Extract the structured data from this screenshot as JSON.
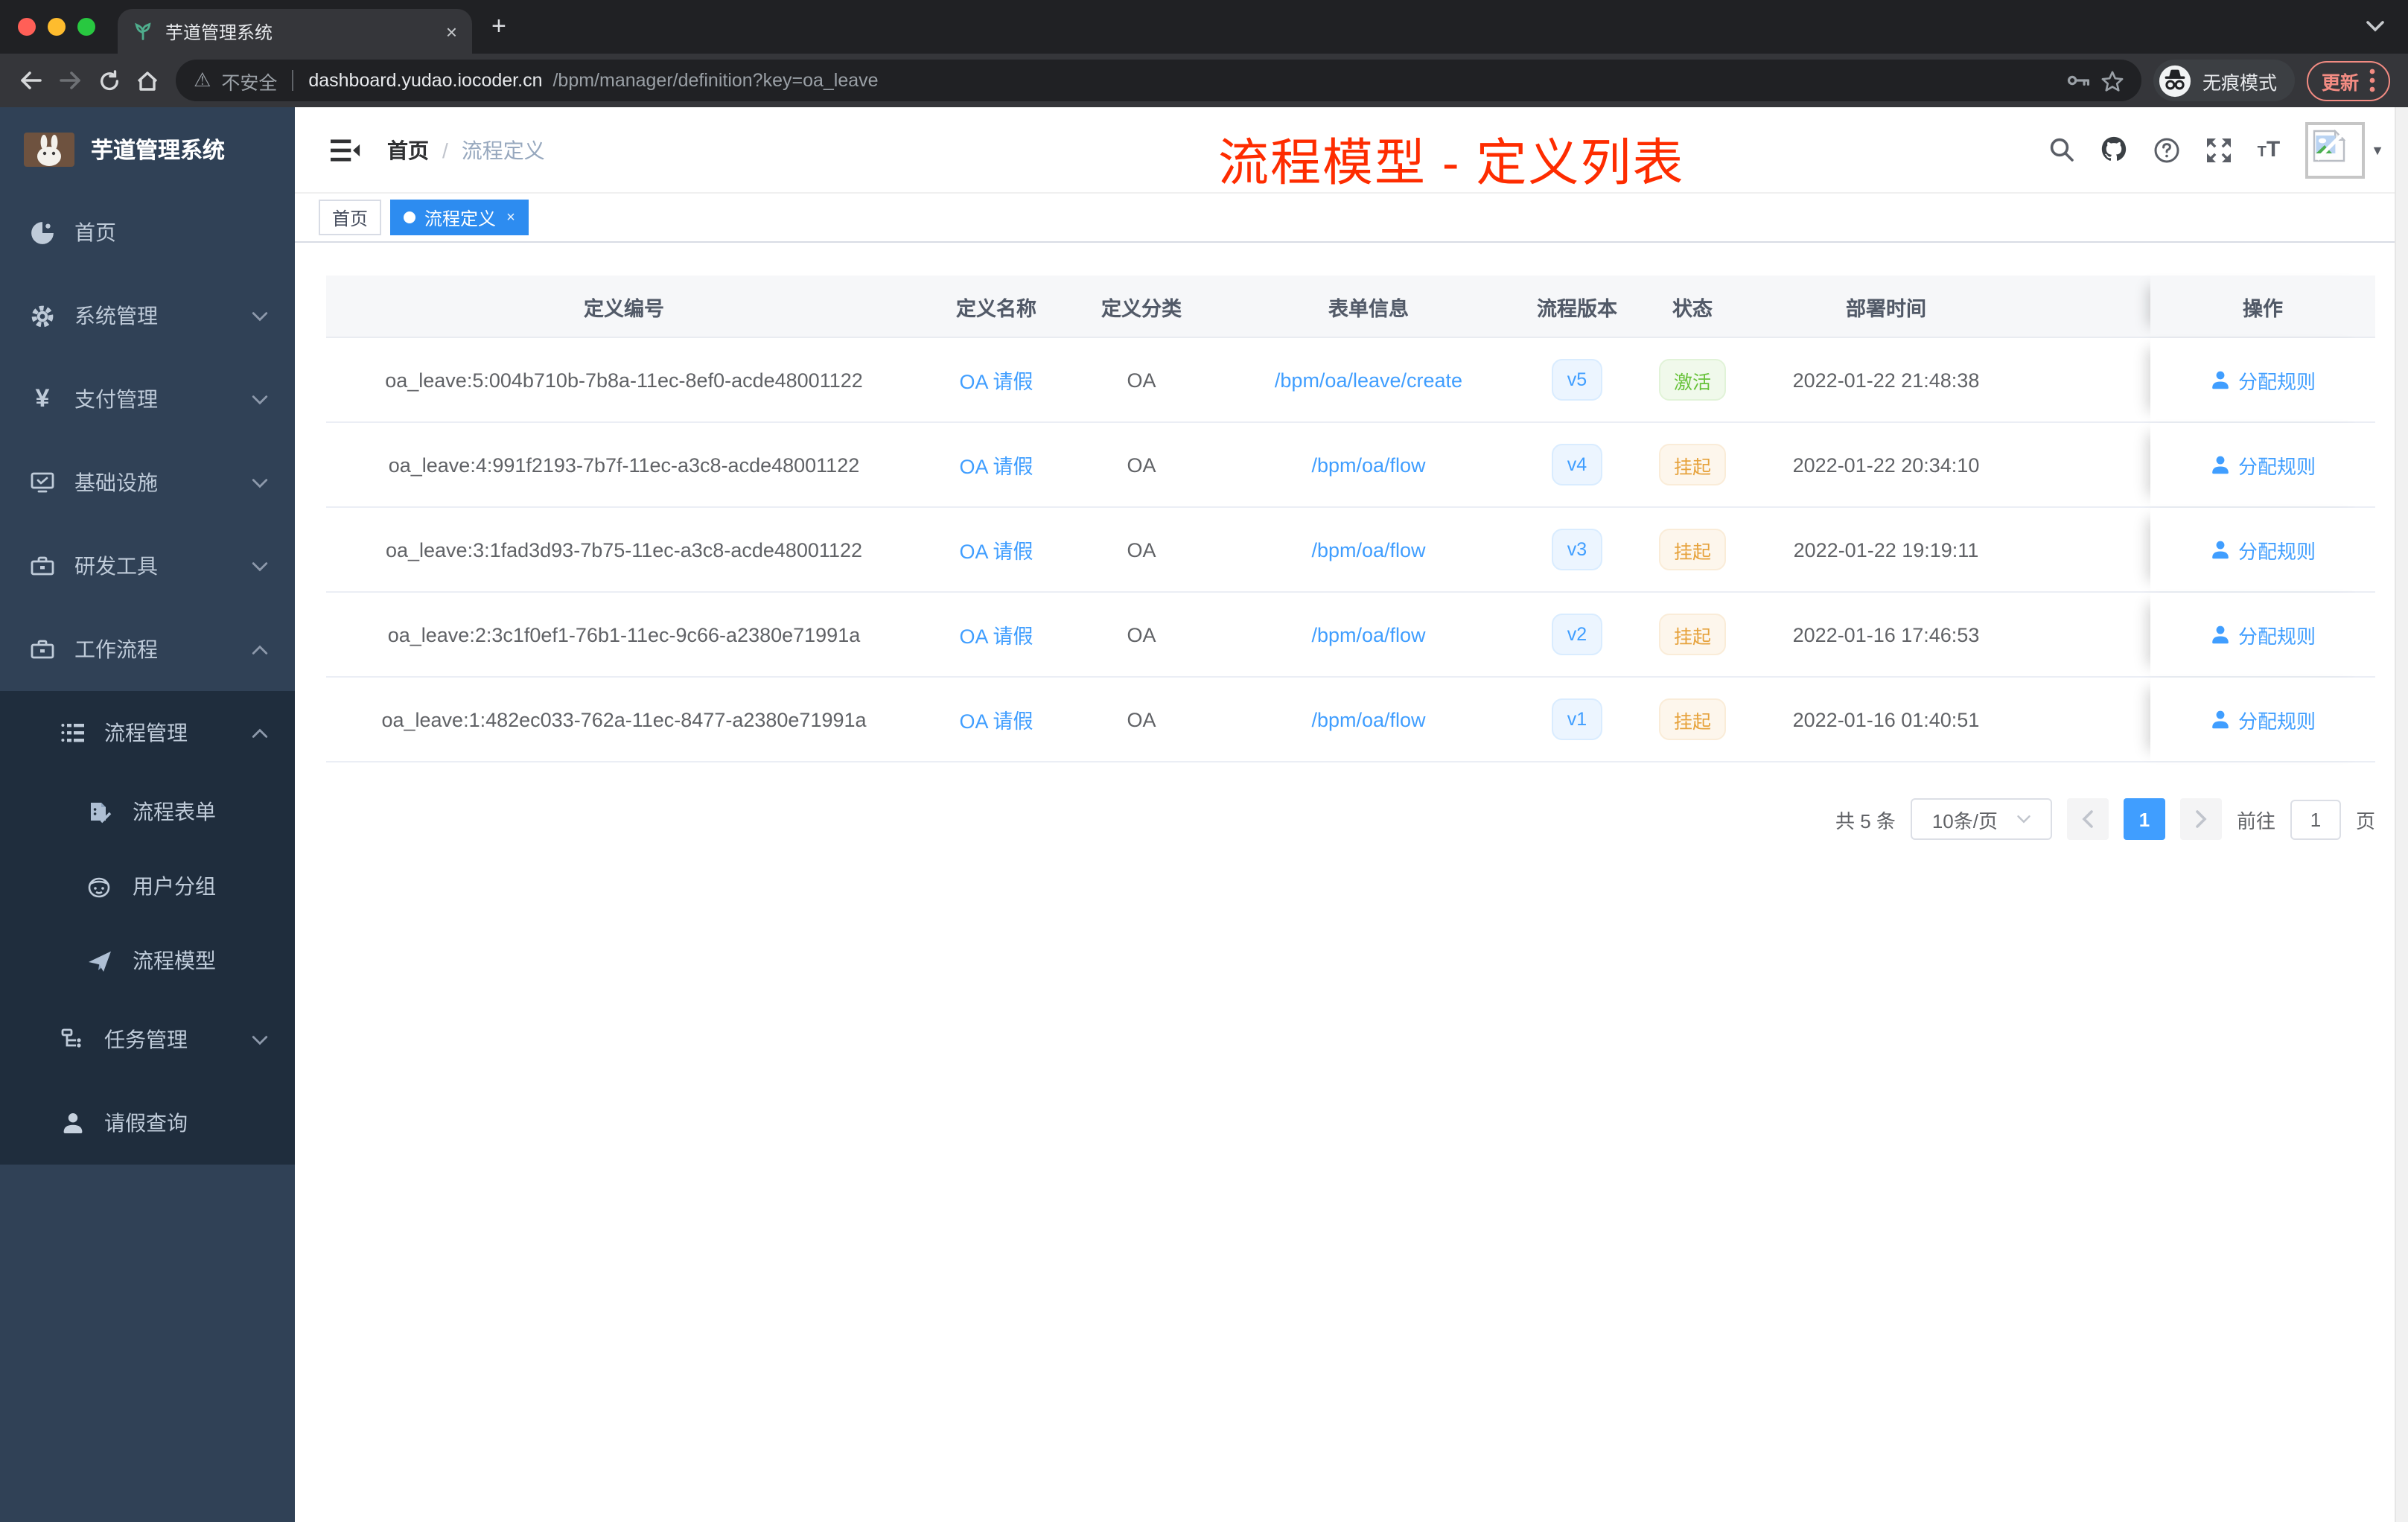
{
  "colors": {
    "accent": "#409eff",
    "title_overlay": "#fe2c00",
    "success": "#67c23a",
    "warning": "#e6a23c",
    "sidebar_bg": "#304156",
    "submenu_bg": "#1f2d3d"
  },
  "browser": {
    "tab_title": "芋道管理系统",
    "tab_close": "×",
    "new_tab": "+",
    "security_label": "不安全",
    "url_domain": "dashboard.yudao.iocoder.cn",
    "url_path": "/bpm/manager/definition?key=oa_leave",
    "incognito_label": "无痕模式",
    "update_label": "更新"
  },
  "sidebar": {
    "brand": "芋道管理系统",
    "items": [
      {
        "label": "首页"
      },
      {
        "label": "系统管理"
      },
      {
        "label": "支付管理"
      },
      {
        "label": "基础设施"
      },
      {
        "label": "研发工具"
      },
      {
        "label": "工作流程"
      }
    ],
    "process_menu": {
      "label": "流程管理"
    },
    "process_children": [
      {
        "label": "流程表单"
      },
      {
        "label": "用户分组"
      },
      {
        "label": "流程模型"
      }
    ],
    "task_menu": {
      "label": "任务管理"
    },
    "leave_item": {
      "label": "请假查询"
    }
  },
  "header": {
    "breadcrumb_home": "首页",
    "breadcrumb_sep": "/",
    "breadcrumb_current": "流程定义"
  },
  "overlay": {
    "title": "流程模型 - 定义列表"
  },
  "tags": {
    "home": "首页",
    "current": "流程定义",
    "close": "×"
  },
  "table": {
    "columns": [
      "定义编号",
      "定义名称",
      "定义分类",
      "表单信息",
      "流程版本",
      "状态",
      "部署时间",
      "操作"
    ],
    "rows": [
      {
        "id": "oa_leave:5:004b710b-7b8a-11ec-8ef0-acde48001122",
        "name": "OA 请假",
        "category": "OA",
        "form": "/bpm/oa/leave/create",
        "version": "v5",
        "status": "激活",
        "status_type": "active",
        "time": "2022-01-22 21:48:38",
        "action": "分配规则"
      },
      {
        "id": "oa_leave:4:991f2193-7b7f-11ec-a3c8-acde48001122",
        "name": "OA 请假",
        "category": "OA",
        "form": "/bpm/oa/flow",
        "version": "v4",
        "status": "挂起",
        "status_type": "suspended",
        "time": "2022-01-22 20:34:10",
        "action": "分配规则"
      },
      {
        "id": "oa_leave:3:1fad3d93-7b75-11ec-a3c8-acde48001122",
        "name": "OA 请假",
        "category": "OA",
        "form": "/bpm/oa/flow",
        "version": "v3",
        "status": "挂起",
        "status_type": "suspended",
        "time": "2022-01-22 19:19:11",
        "action": "分配规则"
      },
      {
        "id": "oa_leave:2:3c1f0ef1-76b1-11ec-9c66-a2380e71991a",
        "name": "OA 请假",
        "category": "OA",
        "form": "/bpm/oa/flow",
        "version": "v2",
        "status": "挂起",
        "status_type": "suspended",
        "time": "2022-01-16 17:46:53",
        "action": "分配规则"
      },
      {
        "id": "oa_leave:1:482ec033-762a-11ec-8477-a2380e71991a",
        "name": "OA 请假",
        "category": "OA",
        "form": "/bpm/oa/flow",
        "version": "v1",
        "status": "挂起",
        "status_type": "suspended",
        "time": "2022-01-16 01:40:51",
        "action": "分配规则"
      }
    ]
  },
  "pagination": {
    "total": "共 5 条",
    "page_size": "10条/页",
    "current_page": "1",
    "goto_label": "前往",
    "page_unit": "页",
    "goto_value": "1"
  }
}
